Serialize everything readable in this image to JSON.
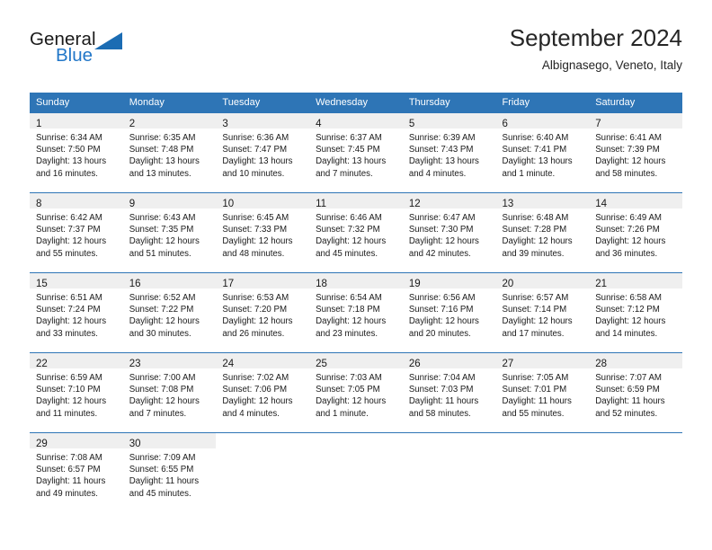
{
  "logo": {
    "word1": "General",
    "word2": "Blue",
    "triangle_color": "#1b6cb3",
    "blue_color": "#2277c8"
  },
  "header": {
    "title": "September 2024",
    "location": "Albignasego, Veneto, Italy"
  },
  "theme": {
    "header_blue": "#2e75b6",
    "date_band_gray": "#efefef",
    "text": "#1a1a1a"
  },
  "weekday_headers": [
    "Sunday",
    "Monday",
    "Tuesday",
    "Wednesday",
    "Thursday",
    "Friday",
    "Saturday"
  ],
  "weeks": [
    [
      {
        "date": "1",
        "sunrise": "Sunrise: 6:34 AM",
        "sunset": "Sunset: 7:50 PM",
        "daylight_l1": "Daylight: 13 hours",
        "daylight_l2": "and 16 minutes."
      },
      {
        "date": "2",
        "sunrise": "Sunrise: 6:35 AM",
        "sunset": "Sunset: 7:48 PM",
        "daylight_l1": "Daylight: 13 hours",
        "daylight_l2": "and 13 minutes."
      },
      {
        "date": "3",
        "sunrise": "Sunrise: 6:36 AM",
        "sunset": "Sunset: 7:47 PM",
        "daylight_l1": "Daylight: 13 hours",
        "daylight_l2": "and 10 minutes."
      },
      {
        "date": "4",
        "sunrise": "Sunrise: 6:37 AM",
        "sunset": "Sunset: 7:45 PM",
        "daylight_l1": "Daylight: 13 hours",
        "daylight_l2": "and 7 minutes."
      },
      {
        "date": "5",
        "sunrise": "Sunrise: 6:39 AM",
        "sunset": "Sunset: 7:43 PM",
        "daylight_l1": "Daylight: 13 hours",
        "daylight_l2": "and 4 minutes."
      },
      {
        "date": "6",
        "sunrise": "Sunrise: 6:40 AM",
        "sunset": "Sunset: 7:41 PM",
        "daylight_l1": "Daylight: 13 hours",
        "daylight_l2": "and 1 minute."
      },
      {
        "date": "7",
        "sunrise": "Sunrise: 6:41 AM",
        "sunset": "Sunset: 7:39 PM",
        "daylight_l1": "Daylight: 12 hours",
        "daylight_l2": "and 58 minutes."
      }
    ],
    [
      {
        "date": "8",
        "sunrise": "Sunrise: 6:42 AM",
        "sunset": "Sunset: 7:37 PM",
        "daylight_l1": "Daylight: 12 hours",
        "daylight_l2": "and 55 minutes."
      },
      {
        "date": "9",
        "sunrise": "Sunrise: 6:43 AM",
        "sunset": "Sunset: 7:35 PM",
        "daylight_l1": "Daylight: 12 hours",
        "daylight_l2": "and 51 minutes."
      },
      {
        "date": "10",
        "sunrise": "Sunrise: 6:45 AM",
        "sunset": "Sunset: 7:33 PM",
        "daylight_l1": "Daylight: 12 hours",
        "daylight_l2": "and 48 minutes."
      },
      {
        "date": "11",
        "sunrise": "Sunrise: 6:46 AM",
        "sunset": "Sunset: 7:32 PM",
        "daylight_l1": "Daylight: 12 hours",
        "daylight_l2": "and 45 minutes."
      },
      {
        "date": "12",
        "sunrise": "Sunrise: 6:47 AM",
        "sunset": "Sunset: 7:30 PM",
        "daylight_l1": "Daylight: 12 hours",
        "daylight_l2": "and 42 minutes."
      },
      {
        "date": "13",
        "sunrise": "Sunrise: 6:48 AM",
        "sunset": "Sunset: 7:28 PM",
        "daylight_l1": "Daylight: 12 hours",
        "daylight_l2": "and 39 minutes."
      },
      {
        "date": "14",
        "sunrise": "Sunrise: 6:49 AM",
        "sunset": "Sunset: 7:26 PM",
        "daylight_l1": "Daylight: 12 hours",
        "daylight_l2": "and 36 minutes."
      }
    ],
    [
      {
        "date": "15",
        "sunrise": "Sunrise: 6:51 AM",
        "sunset": "Sunset: 7:24 PM",
        "daylight_l1": "Daylight: 12 hours",
        "daylight_l2": "and 33 minutes."
      },
      {
        "date": "16",
        "sunrise": "Sunrise: 6:52 AM",
        "sunset": "Sunset: 7:22 PM",
        "daylight_l1": "Daylight: 12 hours",
        "daylight_l2": "and 30 minutes."
      },
      {
        "date": "17",
        "sunrise": "Sunrise: 6:53 AM",
        "sunset": "Sunset: 7:20 PM",
        "daylight_l1": "Daylight: 12 hours",
        "daylight_l2": "and 26 minutes."
      },
      {
        "date": "18",
        "sunrise": "Sunrise: 6:54 AM",
        "sunset": "Sunset: 7:18 PM",
        "daylight_l1": "Daylight: 12 hours",
        "daylight_l2": "and 23 minutes."
      },
      {
        "date": "19",
        "sunrise": "Sunrise: 6:56 AM",
        "sunset": "Sunset: 7:16 PM",
        "daylight_l1": "Daylight: 12 hours",
        "daylight_l2": "and 20 minutes."
      },
      {
        "date": "20",
        "sunrise": "Sunrise: 6:57 AM",
        "sunset": "Sunset: 7:14 PM",
        "daylight_l1": "Daylight: 12 hours",
        "daylight_l2": "and 17 minutes."
      },
      {
        "date": "21",
        "sunrise": "Sunrise: 6:58 AM",
        "sunset": "Sunset: 7:12 PM",
        "daylight_l1": "Daylight: 12 hours",
        "daylight_l2": "and 14 minutes."
      }
    ],
    [
      {
        "date": "22",
        "sunrise": "Sunrise: 6:59 AM",
        "sunset": "Sunset: 7:10 PM",
        "daylight_l1": "Daylight: 12 hours",
        "daylight_l2": "and 11 minutes."
      },
      {
        "date": "23",
        "sunrise": "Sunrise: 7:00 AM",
        "sunset": "Sunset: 7:08 PM",
        "daylight_l1": "Daylight: 12 hours",
        "daylight_l2": "and 7 minutes."
      },
      {
        "date": "24",
        "sunrise": "Sunrise: 7:02 AM",
        "sunset": "Sunset: 7:06 PM",
        "daylight_l1": "Daylight: 12 hours",
        "daylight_l2": "and 4 minutes."
      },
      {
        "date": "25",
        "sunrise": "Sunrise: 7:03 AM",
        "sunset": "Sunset: 7:05 PM",
        "daylight_l1": "Daylight: 12 hours",
        "daylight_l2": "and 1 minute."
      },
      {
        "date": "26",
        "sunrise": "Sunrise: 7:04 AM",
        "sunset": "Sunset: 7:03 PM",
        "daylight_l1": "Daylight: 11 hours",
        "daylight_l2": "and 58 minutes."
      },
      {
        "date": "27",
        "sunrise": "Sunrise: 7:05 AM",
        "sunset": "Sunset: 7:01 PM",
        "daylight_l1": "Daylight: 11 hours",
        "daylight_l2": "and 55 minutes."
      },
      {
        "date": "28",
        "sunrise": "Sunrise: 7:07 AM",
        "sunset": "Sunset: 6:59 PM",
        "daylight_l1": "Daylight: 11 hours",
        "daylight_l2": "and 52 minutes."
      }
    ],
    [
      {
        "date": "29",
        "sunrise": "Sunrise: 7:08 AM",
        "sunset": "Sunset: 6:57 PM",
        "daylight_l1": "Daylight: 11 hours",
        "daylight_l2": "and 49 minutes."
      },
      {
        "date": "30",
        "sunrise": "Sunrise: 7:09 AM",
        "sunset": "Sunset: 6:55 PM",
        "daylight_l1": "Daylight: 11 hours",
        "daylight_l2": "and 45 minutes."
      },
      {
        "date": "",
        "sunrise": "",
        "sunset": "",
        "daylight_l1": "",
        "daylight_l2": ""
      },
      {
        "date": "",
        "sunrise": "",
        "sunset": "",
        "daylight_l1": "",
        "daylight_l2": ""
      },
      {
        "date": "",
        "sunrise": "",
        "sunset": "",
        "daylight_l1": "",
        "daylight_l2": ""
      },
      {
        "date": "",
        "sunrise": "",
        "sunset": "",
        "daylight_l1": "",
        "daylight_l2": ""
      },
      {
        "date": "",
        "sunrise": "",
        "sunset": "",
        "daylight_l1": "",
        "daylight_l2": ""
      }
    ]
  ]
}
